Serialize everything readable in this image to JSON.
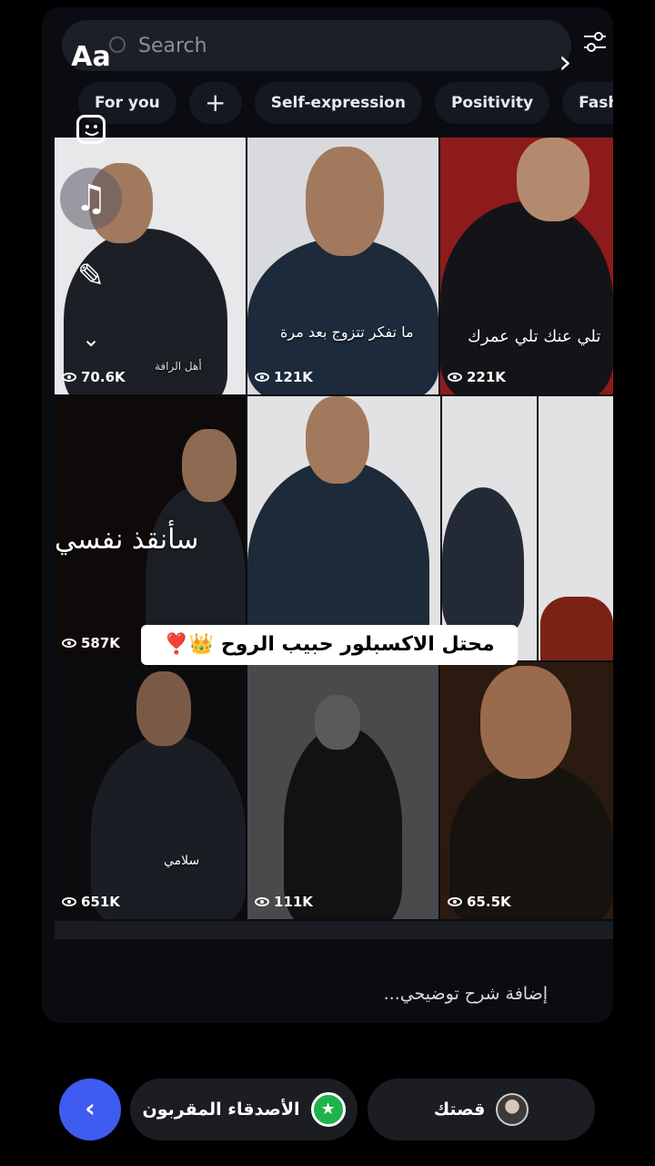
{
  "search": {
    "placeholder": "Search"
  },
  "tabs": [
    {
      "label": "For you"
    },
    {
      "label": "+"
    },
    {
      "label": "Self-expression"
    },
    {
      "label": "Positivity"
    },
    {
      "label": "Fashion"
    }
  ],
  "side_tools": {
    "text_label": "Aa",
    "music_glyph": "♫",
    "pen_glyph": "✎",
    "more_glyph": "⌄"
  },
  "grid": {
    "cells": [
      {
        "views": "70.6K",
        "caption": "أهل الرافة"
      },
      {
        "views": "121K",
        "caption": "ما تفكر تتزوج بعد مرة"
      },
      {
        "views": "221K",
        "caption": "تلي عنك تلي عمرك"
      },
      {
        "views": "587K",
        "caption": "سأنقذ نفسي"
      },
      {
        "views": "",
        "caption": ""
      },
      {
        "views": "651K",
        "caption": "سلامي"
      },
      {
        "views": "111K",
        "caption": ""
      },
      {
        "views": "65.5K",
        "caption": ""
      }
    ]
  },
  "overlay_text": "محتل الاكسبلور حبيب الروح 👑❣️",
  "add_caption": "إضافة شرح توضيحي...",
  "bottom": {
    "back_glyph": "‹",
    "close_friends_label": "الأصدقاء المقربون",
    "story_label": "قصتك",
    "star_glyph": "★"
  },
  "colors": {
    "accent": "#3e5cf0",
    "star_green": "#1fb24a",
    "pill_bg": "#1b1d22"
  }
}
